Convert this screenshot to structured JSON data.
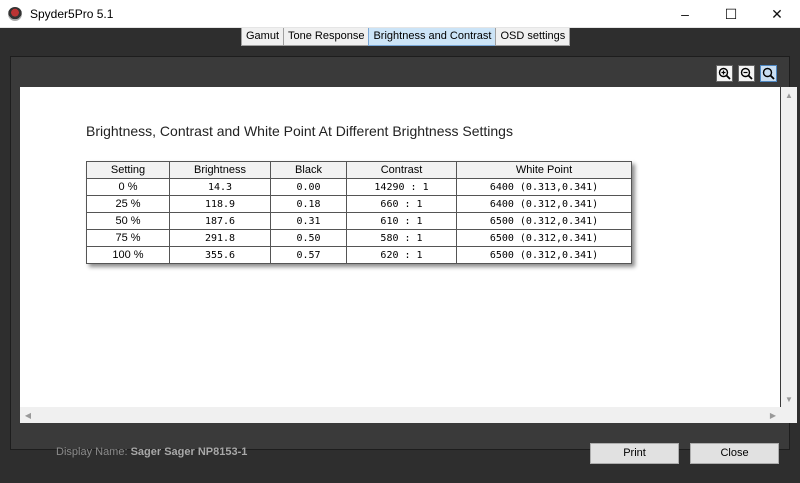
{
  "window": {
    "title": "Spyder5Pro 5.1"
  },
  "tabs": [
    "Gamut",
    "Tone Response",
    "Brightness and Contrast",
    "OSD settings"
  ],
  "report": {
    "title": "Brightness, Contrast and White Point At Different Brightness Settings",
    "columns": [
      "Setting",
      "Brightness",
      "Black",
      "Contrast",
      "White Point"
    ],
    "rows": [
      [
        "0 %",
        "14.3",
        "0.00",
        "14290 : 1",
        "6400 (0.313,0.341)"
      ],
      [
        "25 %",
        "118.9",
        "0.18",
        "660 : 1",
        "6400 (0.312,0.341)"
      ],
      [
        "50 %",
        "187.6",
        "0.31",
        "610 : 1",
        "6500 (0.312,0.341)"
      ],
      [
        "75 %",
        "291.8",
        "0.50",
        "580 : 1",
        "6500 (0.312,0.341)"
      ],
      [
        "100 %",
        "355.6",
        "0.57",
        "620 : 1",
        "6500 (0.312,0.341)"
      ]
    ]
  },
  "footer": {
    "display_label": "Display Name:",
    "display_value": "Sager Sager NP8153-1",
    "print_label": "Print",
    "close_label": "Close"
  }
}
